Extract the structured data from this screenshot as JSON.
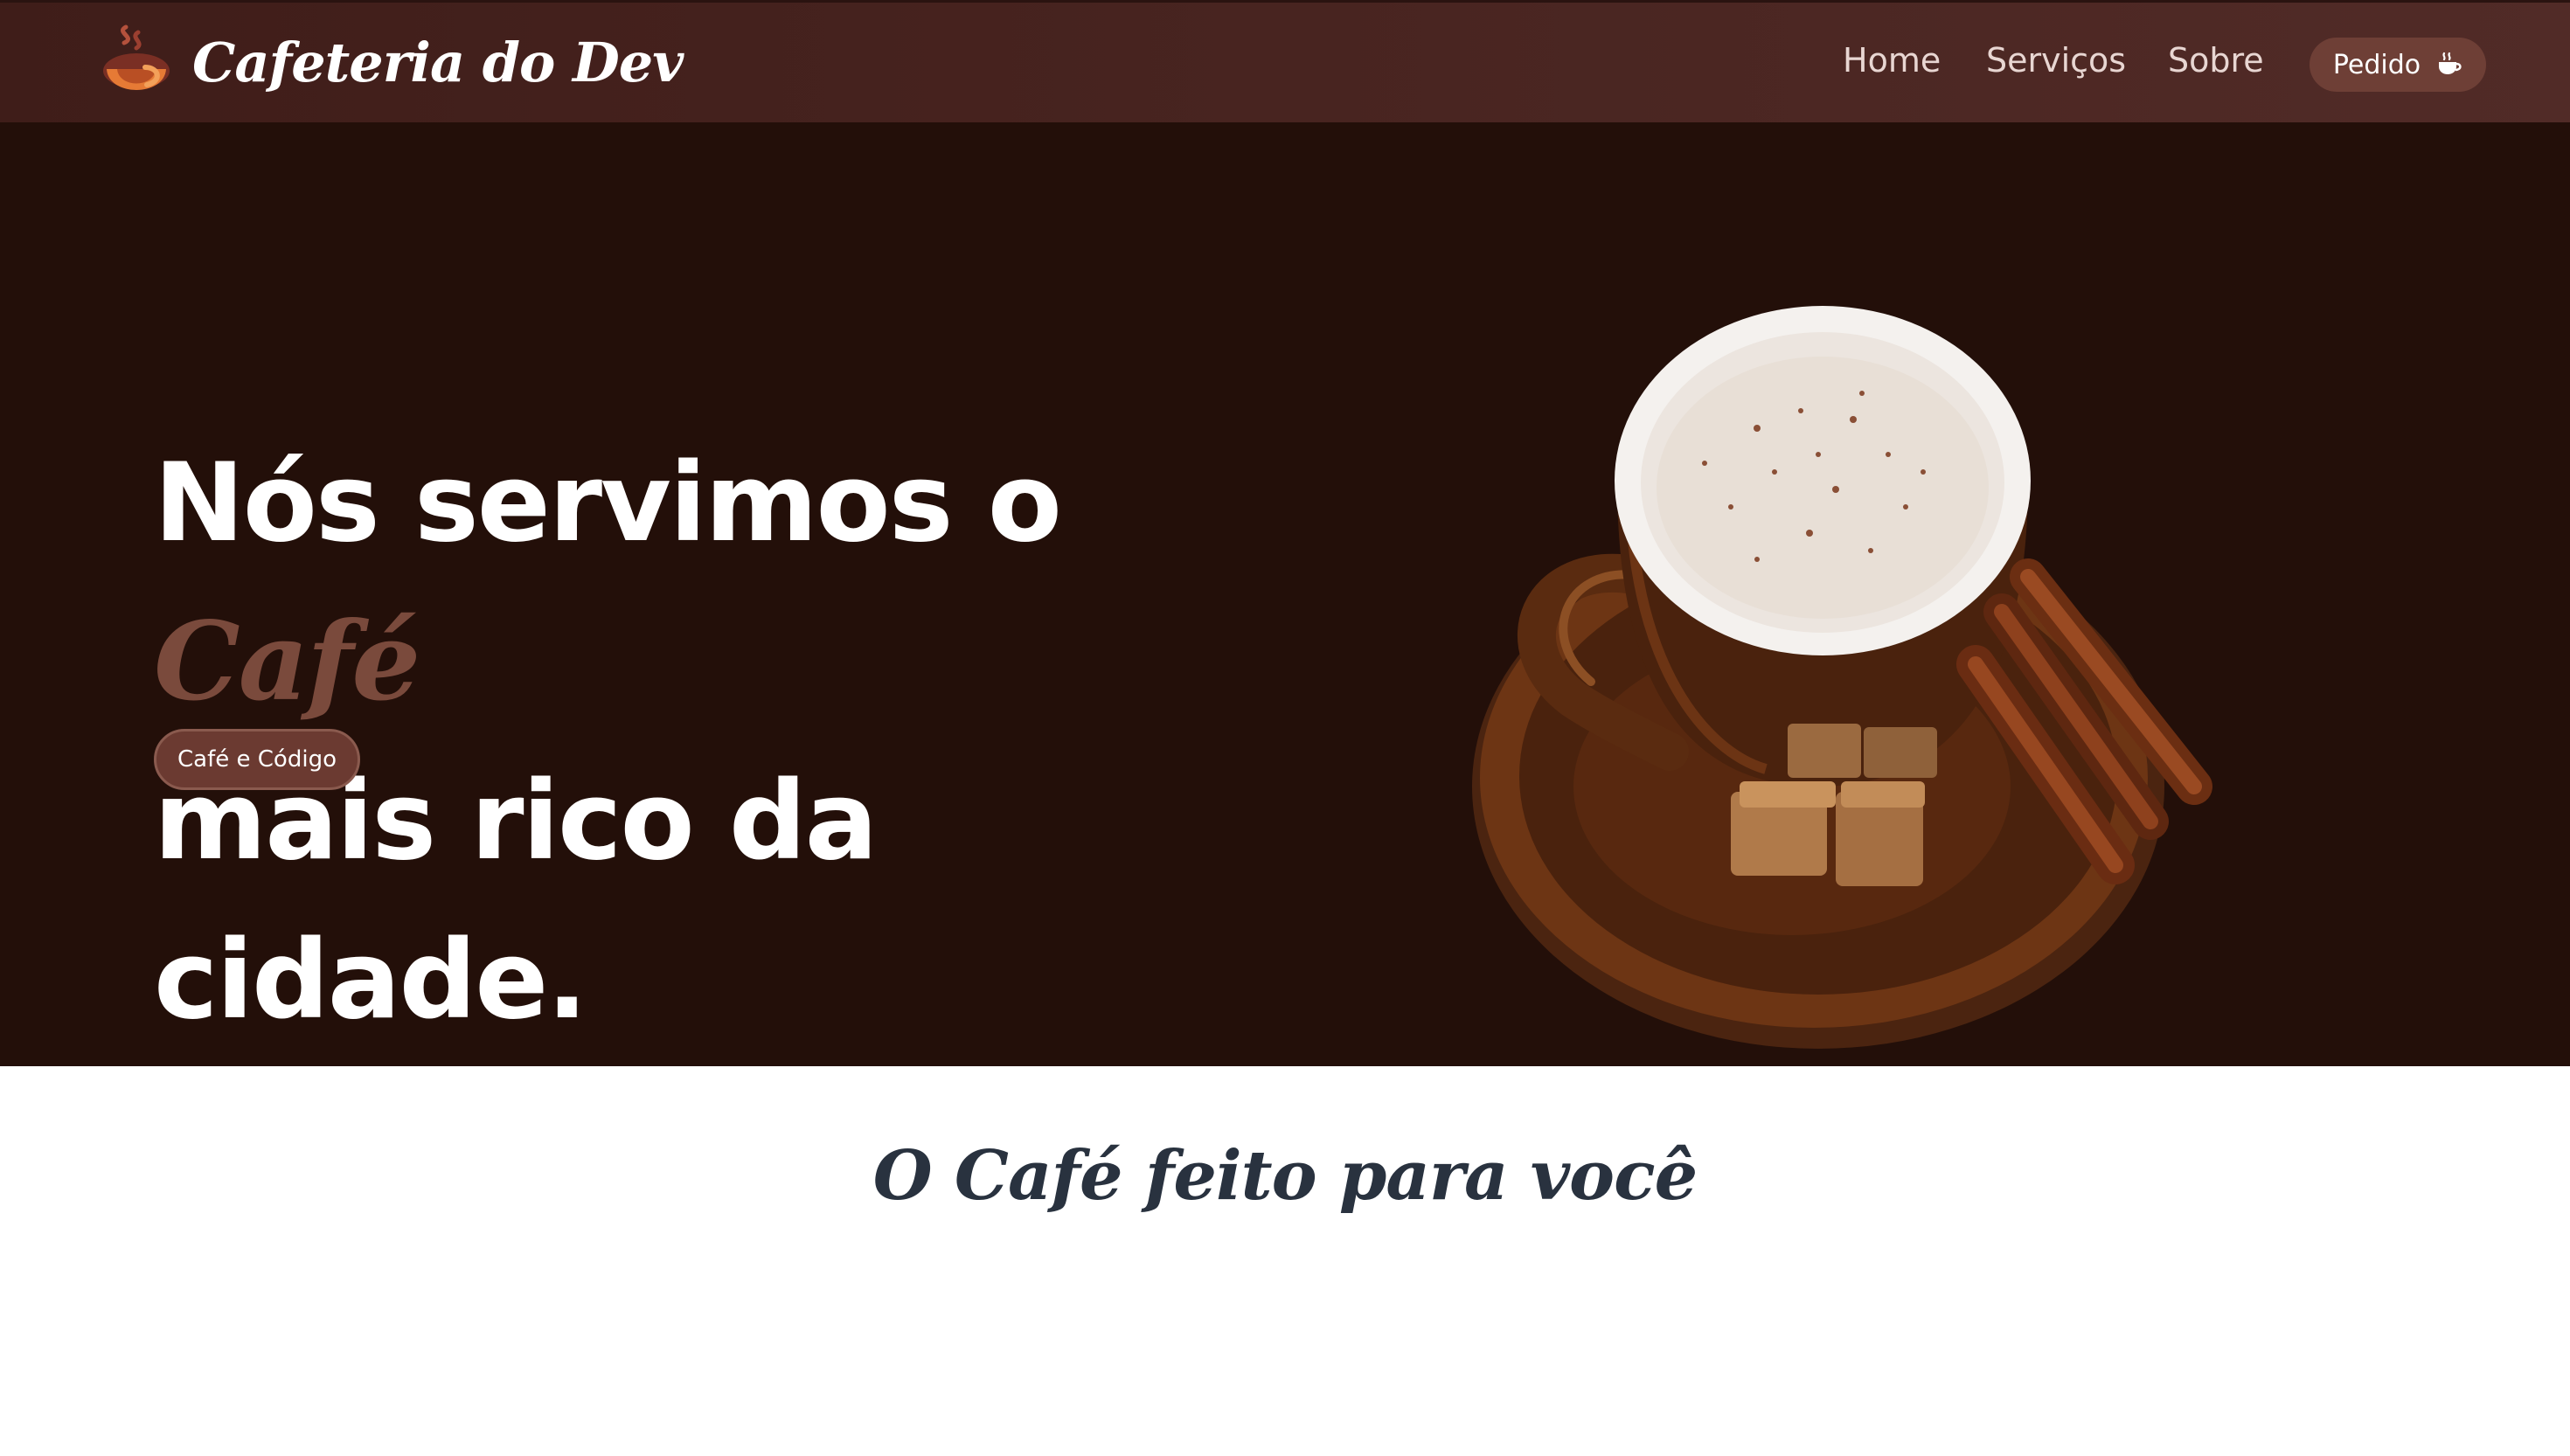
{
  "brand": {
    "name": "Cafeteria do Dev"
  },
  "nav": {
    "items": [
      {
        "label": "Home"
      },
      {
        "label": "Serviços"
      },
      {
        "label": "Sobre"
      }
    ],
    "order_button": "Pedido"
  },
  "hero": {
    "title_prefix": "Nós servimos o ",
    "title_accent": "Café",
    "title_suffix": "mais rico da cidade.",
    "cta": "Café e Código"
  },
  "section": {
    "title": "O Café feito para você"
  },
  "colors": {
    "nav_bg": "#4a2520",
    "hero_bg": "#230f09",
    "accent": "#7a4a3c",
    "button_bg": "#6b3a31",
    "section_title": "#29323f"
  },
  "icons": {
    "logo": "coffee-logo-icon",
    "order": "coffee-cup-icon"
  }
}
